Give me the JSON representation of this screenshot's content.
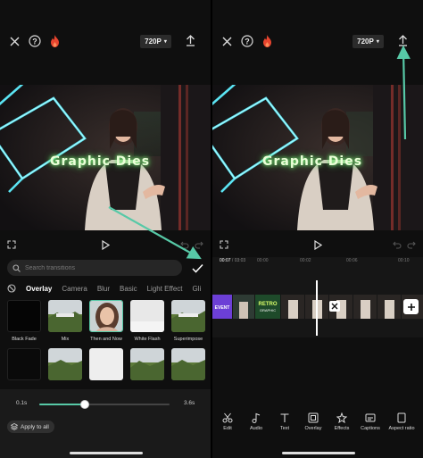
{
  "colors": {
    "accent": "#57c9a7",
    "background": "#0f0f0f",
    "neon": "#5ff0ff"
  },
  "left": {
    "header": {
      "resolution": "720P"
    },
    "search": {
      "placeholder": "Search transitions"
    },
    "tabs": [
      "Overlay",
      "Camera",
      "Blur",
      "Basic",
      "Light Effect",
      "Gli"
    ],
    "transitions_row1": [
      "Black Fade",
      "Mix",
      "Then and Now",
      "White Flash",
      "Superimpose"
    ],
    "slider": {
      "min_label": "0.1s",
      "max_label": "3.6s",
      "value_fraction": 0.35
    },
    "apply_all_label": "Apply to all"
  },
  "right": {
    "header": {
      "resolution": "720P"
    },
    "timecode": {
      "current": "00:07",
      "total": "03:03"
    },
    "ruler": [
      "00:00",
      "00:02",
      "00:06",
      "00:10"
    ],
    "overlay_text": "Graphic Dies",
    "tools": [
      "Edit",
      "Audio",
      "Text",
      "Overlay",
      "Effects",
      "Captions",
      "Aspect ratio"
    ]
  }
}
